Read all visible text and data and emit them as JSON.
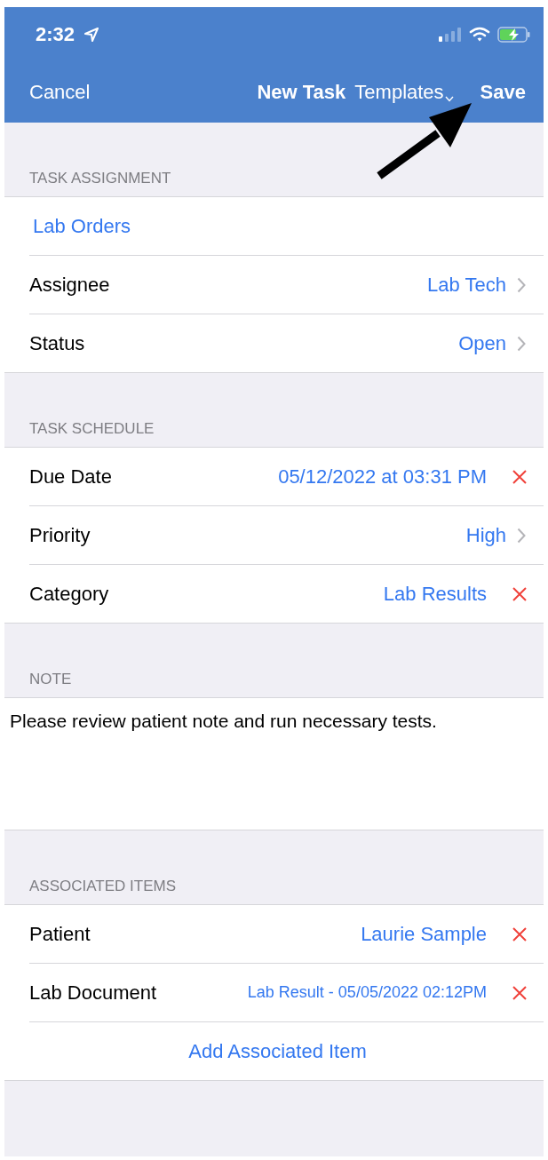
{
  "status_bar": {
    "time": "2:32"
  },
  "nav_bar": {
    "cancel": "Cancel",
    "title": "New Task",
    "templates": "Templates",
    "save": "Save"
  },
  "sections": [
    {
      "header": "TASK ASSIGNMENT",
      "rows": [
        {
          "kind": "link",
          "value": "Lab Orders"
        },
        {
          "kind": "nav",
          "label": "Assignee",
          "value": "Lab Tech"
        },
        {
          "kind": "nav",
          "label": "Status",
          "value": "Open"
        }
      ]
    },
    {
      "header": "TASK SCHEDULE",
      "rows": [
        {
          "kind": "clear",
          "label": "Due Date",
          "value": "05/12/2022 at 03:31 PM"
        },
        {
          "kind": "nav",
          "label": "Priority",
          "value": "High"
        },
        {
          "kind": "clear",
          "label": "Category",
          "value": "Lab Results"
        }
      ]
    },
    {
      "header": "NOTE",
      "rows": [
        {
          "kind": "note",
          "value": "Please review patient note and run necessary tests."
        }
      ]
    },
    {
      "header": "ASSOCIATED ITEMS",
      "rows": [
        {
          "kind": "clear",
          "label": "Patient",
          "value": "Laurie Sample"
        },
        {
          "kind": "clear",
          "small": true,
          "label": "Lab Document",
          "value": "Lab Result - 05/05/2022 02:12PM"
        },
        {
          "kind": "action",
          "value": "Add Associated Item"
        }
      ]
    }
  ]
}
